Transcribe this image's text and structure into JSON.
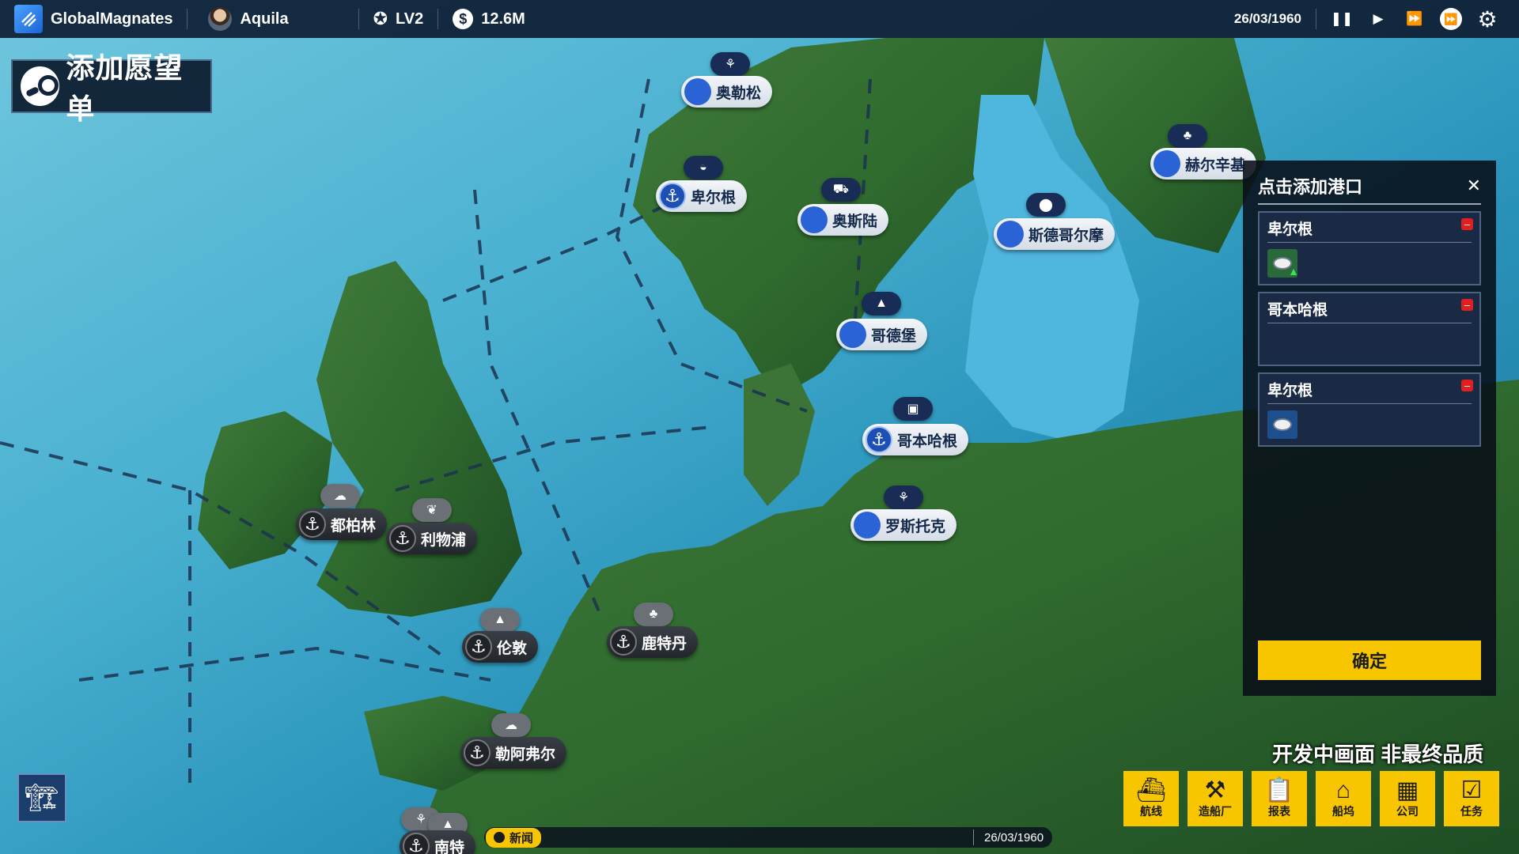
{
  "topbar": {
    "app_name": "GlobalMagnates",
    "player_name": "Aquila",
    "level": "LV2",
    "money": "12.6M",
    "date": "26/03/1960"
  },
  "wishlist": {
    "label": "添加愿望单"
  },
  "ports": [
    {
      "name": "奥勒松"
    },
    {
      "name": "卑尔根"
    },
    {
      "name": "奥斯陆"
    },
    {
      "name": "斯德哥尔摩"
    },
    {
      "name": "赫尔辛基"
    },
    {
      "name": "哥德堡"
    },
    {
      "name": "哥本哈根"
    },
    {
      "name": "罗斯托克"
    },
    {
      "name": "都柏林"
    },
    {
      "name": "利物浦"
    },
    {
      "name": "伦敦"
    },
    {
      "name": "鹿特丹"
    },
    {
      "name": "勒阿弗尔"
    },
    {
      "name": "南特"
    }
  ],
  "panel": {
    "title": "点击添加港口",
    "close_label": "✕",
    "cards": [
      {
        "name": "卑尔根",
        "cargo_icon": "fish-icon"
      },
      {
        "name": "哥本哈根"
      },
      {
        "name": "卑尔根",
        "cargo_icon": "fish-icon"
      }
    ],
    "confirm_label": "确定"
  },
  "dev_note": "开发中画面 非最终品质",
  "bottom_buttons": [
    {
      "label": "航线",
      "icon": "route-icon"
    },
    {
      "label": "造船厂",
      "icon": "shipyard-icon"
    },
    {
      "label": "报表",
      "icon": "report-icon"
    },
    {
      "label": "船坞",
      "icon": "dock-icon"
    },
    {
      "label": "公司",
      "icon": "company-icon"
    },
    {
      "label": "任务",
      "icon": "task-icon"
    }
  ],
  "news": {
    "tag": "新闻",
    "date": "26/03/1960"
  },
  "colors": {
    "accent": "#f7c600",
    "topbar": "#0e1e34",
    "sea": "#49b0d0"
  }
}
